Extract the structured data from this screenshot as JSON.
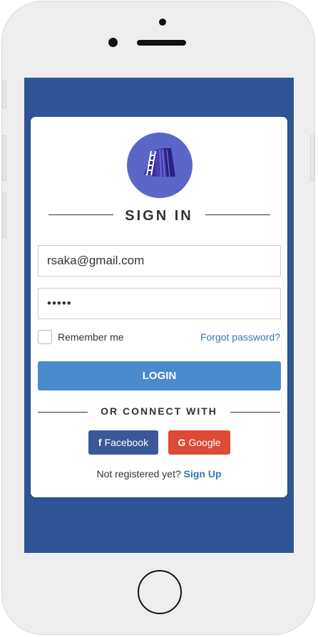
{
  "app": {
    "title": "SIGN IN",
    "logo_icon": "building-ladder-icon"
  },
  "form": {
    "email_value": "rsaka@gmail.com",
    "password_value": "•••••",
    "remember_label": "Remember me",
    "forgot_label": "Forgot password?",
    "login_label": "LOGIN"
  },
  "connect": {
    "heading": "OR CONNECT WITH",
    "facebook_label": "Facebook",
    "facebook_icon_glyph": "f",
    "google_label": "Google",
    "google_icon_glyph": "G"
  },
  "footer": {
    "prompt": "Not registered yet? ",
    "signup_label": "Sign Up"
  },
  "colors": {
    "screen_bg": "#2f5597",
    "login_button": "#4a8acd",
    "facebook": "#3b5998",
    "google": "#dc4a38",
    "link": "#3e76ad",
    "logo_bg": "#5a67c9"
  }
}
